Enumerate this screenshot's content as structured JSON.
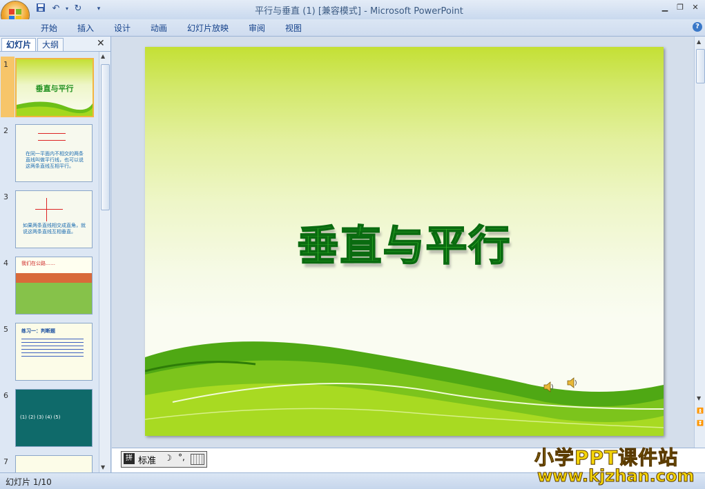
{
  "window": {
    "title": "平行与垂直 (1) [兼容模式] - Microsoft PowerPoint"
  },
  "ribbon": {
    "tabs": [
      "开始",
      "插入",
      "设计",
      "动画",
      "幻灯片放映",
      "审阅",
      "视图"
    ]
  },
  "panel": {
    "tabs": [
      "幻灯片",
      "大纲"
    ]
  },
  "thumbnails": [
    {
      "num": "1",
      "title": "垂直与平行"
    },
    {
      "num": "2",
      "text": "在同一平面内不相交的两条直线叫做平行线，也可以说这两条直线互相平行。"
    },
    {
      "num": "3",
      "text": "如果两条直线相交成直角，就说这两条直线互相垂直。"
    },
    {
      "num": "4",
      "text": "我们在公路……"
    },
    {
      "num": "5",
      "text": "练习一：判断题"
    },
    {
      "num": "6",
      "text": "(1) (2) (3) (4) (5)"
    },
    {
      "num": "7",
      "text": ""
    }
  ],
  "slide": {
    "title": "垂直与平行"
  },
  "ime": {
    "label": "标准"
  },
  "status": {
    "text": "幻灯片 1/10"
  },
  "watermark": {
    "line1": "小学PPT课件站",
    "line2": "www.kjzhan.com"
  },
  "colors": {
    "slide_green": "#35b82a",
    "accent": "#f3b440"
  }
}
